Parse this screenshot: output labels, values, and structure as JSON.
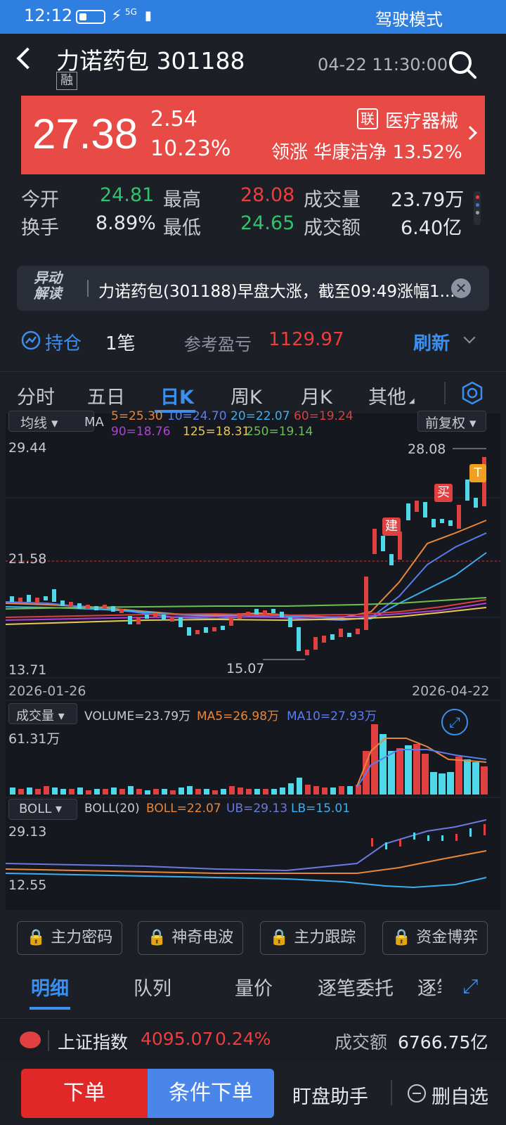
{
  "status": {
    "time": "12:12",
    "net": "5G",
    "mode": "驾驶模式"
  },
  "header": {
    "name": "力诺药包 301188",
    "tag": "融",
    "datetime": "04-22 11:30:00"
  },
  "price": {
    "last": "27.38",
    "change": "2.54",
    "pct": "10.23%",
    "badge": "联",
    "sector": "医疗器械",
    "lead": "领涨 华康洁净 13.52%"
  },
  "stats": {
    "open_label": "今开",
    "open": "24.81",
    "high_label": "最高",
    "high": "28.08",
    "vol_label": "成交量",
    "vol": "23.79万",
    "turn_label": "换手",
    "turn": "8.89%",
    "low_label": "最低",
    "low": "24.65",
    "amt_label": "成交额",
    "amt": "6.40亿"
  },
  "notice": {
    "tag1": "异动",
    "tag2": "解读",
    "text": "力诺药包(301188)早盘大涨，截至09:49涨幅1..."
  },
  "holding": {
    "label": "持仓",
    "count": "1笔",
    "pnl_label": "参考盈亏",
    "pnl": "1129.97",
    "refresh": "刷新"
  },
  "tabs": [
    "分时",
    "五日",
    "日K",
    "周K",
    "月K",
    "其他"
  ],
  "chart_labels": {
    "ma_select": "均线",
    "ma_title": "MA",
    "ma5": "5=25.30",
    "ma10": "10=24.70",
    "ma20": "20=22.07",
    "ma60": "60=19.24",
    "ma90": "90=18.76",
    "ma125": "125=18.31",
    "ma250": "250=19.14",
    "fq": "前复权",
    "y_top": "29.44",
    "y_mid": "21.58",
    "y_bot": "13.71",
    "hi_mark": "28.08",
    "lo_mark": "15.07",
    "date_start": "2026-01-26",
    "date_end": "2026-04-22",
    "mk_jian": "建",
    "mk_mai": "买",
    "mk_t": "T",
    "vol_select": "成交量",
    "vol_text": "VOLUME=23.79万",
    "vol_ma5": "MA5=26.98万",
    "vol_ma10": "MA10=27.93万",
    "vol_top": "61.31万",
    "boll_select": "BOLL",
    "boll_title": "BOLL(20)",
    "boll_mid": "BOLL=22.07",
    "boll_ub": "UB=29.13",
    "boll_lb": "LB=15.01",
    "boll_top": "29.13",
    "boll_bot": "12.55"
  },
  "lock_buttons": [
    "主力密码",
    "神奇电波",
    "主力跟踪",
    "资金博弈"
  ],
  "bottom_tabs": [
    "明细",
    "队列",
    "量价",
    "逐笔委托",
    "逐笔"
  ],
  "index": {
    "name": "上证指数",
    "value": "4095.07",
    "pct": "0.24%",
    "amt_label": "成交额",
    "amt": "6766.75亿"
  },
  "actions": {
    "order": "下单",
    "cond": "条件下单",
    "watch": "盯盘助手",
    "remove": "删自选"
  },
  "colors": {
    "up": "#f03c3c",
    "down": "#4fd8e8",
    "accent": "#2f7fe0",
    "price_bg": "#e84a46"
  }
}
